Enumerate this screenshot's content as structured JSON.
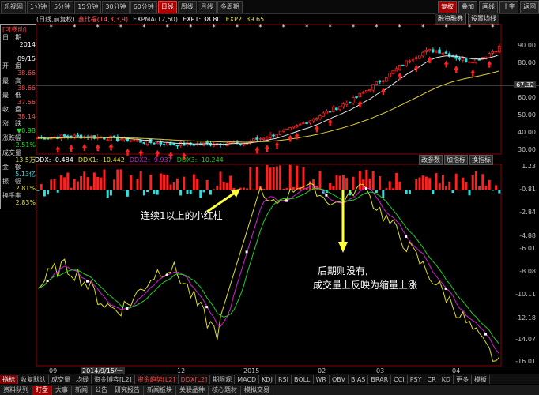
{
  "toolbar": {
    "app_name": "乐视网",
    "periods": [
      "1分钟",
      "5分钟",
      "15分钟",
      "30分钟",
      "60分钟",
      "日线",
      "周线",
      "月线",
      "多周期"
    ],
    "active_period": "日线",
    "right_buttons": [
      "复权",
      "叠加",
      "画线",
      "十字",
      "返回"
    ]
  },
  "infoline": {
    "subtitle": "(日线,前复权)",
    "indicator": "鑫比福(14,3,3,9)",
    "expma": "EXPMA(12,50)",
    "exp1": "EXP1: 38.80",
    "exp2": "EXP2: 39.65",
    "btn_fund": "融资融券",
    "btn_set": "设置均线"
  },
  "left_panel": {
    "title": "[可卷动]",
    "rows": [
      {
        "label": "日　期",
        "value": "2014"
      },
      {
        "label": "",
        "value": "09/15"
      },
      {
        "label": "开　盘",
        "value": "38.66"
      },
      {
        "label": "最　高",
        "value": "38.66"
      },
      {
        "label": "最　低",
        "value": "37.56"
      },
      {
        "label": "收　盘",
        "value": "38.14"
      },
      {
        "label": "涨　跌",
        "value": "▼0.98"
      },
      {
        "label": "涨跌幅",
        "value": "-2.51%"
      },
      {
        "label": "成交量",
        "value": "13.5万"
      },
      {
        "label": "金　额",
        "value": "5.13亿"
      },
      {
        "label": "振　幅",
        "value": "2.81%"
      },
      {
        "label": "换手率",
        "value": "2.83%"
      }
    ]
  },
  "price_axis": [
    "90.00",
    "80.00",
    "67.32",
    "60.00",
    "50.00",
    "40.00",
    "30.00"
  ],
  "ind_header": {
    "ddx": "DDX: -0.484",
    "ddx1": "DDX1: -10.442",
    "ddx2": "DDX2: -9.937",
    "ddx3": "DDX3: -10.244",
    "btn1": "改参数",
    "btn2": "加指标",
    "btn3": "换指标"
  },
  "ind_axis": [
    "1.23",
    "-0.81",
    "-2.84",
    "-4.88",
    "-6.01",
    "-8.08",
    "-10.11",
    "-12.18",
    "-14.07",
    "-16.01"
  ],
  "annotations": {
    "a1": "连续1以上的小红柱",
    "a2_line1": "后期则没有,",
    "a2_line2": "成交量上反映为缩量上涨"
  },
  "datebar": {
    "labels": [
      "09",
      "2014/9/15/一",
      "12",
      "2015",
      "02",
      "03",
      "04"
    ]
  },
  "tabs": [
    "指标",
    "收复默认",
    "成交量",
    "均线",
    "资金博弈[L2]",
    "资金趋势[L2]",
    "DDX[L2]",
    "期限观",
    "MACD",
    "KDJ",
    "RSI",
    "BOLL",
    "WR",
    "OBV",
    "BIAS",
    "BRAR",
    "CCI",
    "PSY",
    "CR",
    "KD",
    "更多",
    "模板"
  ],
  "active_tab": "指标",
  "bottom_tabs": [
    "资料队列",
    "盯盘",
    "大事",
    "新闻",
    "公告",
    "研究报告",
    "新闻板块",
    "关联品种",
    "核心题材",
    "模拟交易"
  ],
  "active_bottom": "盯盘",
  "colors": {
    "up": "#ff2020",
    "down": "#30e0e0",
    "ma_white": "#e0e0e0",
    "ma_yellow": "#e0d040",
    "ddx_yellow": "#e0e020",
    "ddx_green": "#20d020",
    "ddx_magenta": "#d020d0"
  }
}
